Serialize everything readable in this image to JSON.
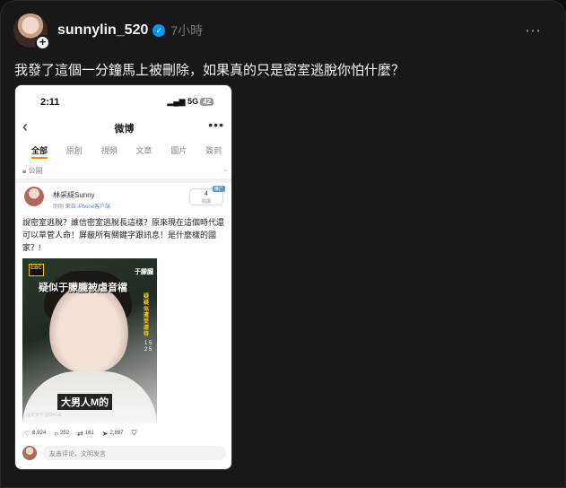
{
  "post": {
    "username": "sunnylin_520",
    "verified_mark": "✓",
    "time": "7小時",
    "more_icon": "⋯",
    "avatar_plus": "+",
    "text": "我發了這個一分鐘馬上被刪除，如果真的只是密室逃脫你怕什麼？"
  },
  "screenshot": {
    "status": {
      "time": "2:11",
      "signal": "5G",
      "battery": "42"
    },
    "nav": {
      "back": "‹",
      "title": "微博",
      "more": "•••"
    },
    "tabs": [
      {
        "label": "全部",
        "active": true
      },
      {
        "label": "原創",
        "active": false
      },
      {
        "label": "視頻",
        "active": false
      },
      {
        "label": "文章",
        "active": false
      },
      {
        "label": "圖片",
        "active": false
      },
      {
        "label": "簽到",
        "active": false
      }
    ],
    "visibility": "公開",
    "author": {
      "name": "林采緹Sunny",
      "meta_prefix": "剛剛",
      "source": "來自 iPhone客户端",
      "follow_count": "4",
      "follow_label": "閱讀",
      "follow_tag": "推广"
    },
    "body": "說密室逃脫？誰信密室逃脫長這樣？原來現在這個時代還可以草菅人命！屏蔽所有關鍵字跟訊息！是什麼樣的國家？!",
    "image": {
      "logo": "EBC",
      "top_name": "于朦朧",
      "headline": "疑似于朦朧被虐音檔",
      "vertical_text": "疑疑似遭受虐待",
      "vertical_text2": "1 5 2 5",
      "caption": "大男人M的",
      "watermark": "@天天不說MAGE"
    },
    "actions": {
      "likes": "6,924",
      "comments": "252",
      "reposts": "161",
      "shares": "2,897"
    },
    "comment_placeholder": "友善评论，文明发言"
  }
}
